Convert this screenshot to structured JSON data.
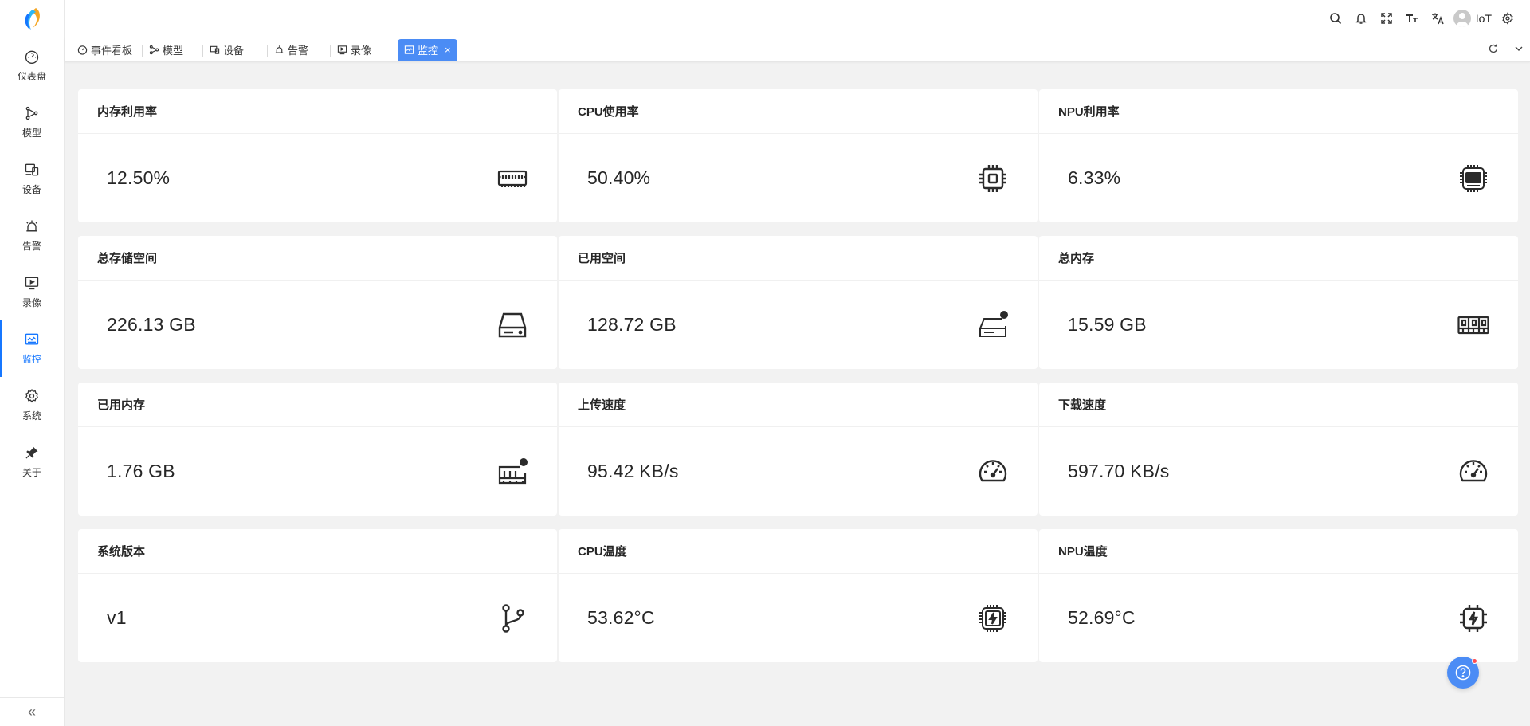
{
  "sidebar": {
    "items": [
      {
        "label": "仪表盘",
        "icon": "gauge-icon"
      },
      {
        "label": "模型",
        "icon": "graph-icon"
      },
      {
        "label": "设备",
        "icon": "devices-icon"
      },
      {
        "label": "告警",
        "icon": "alarm-icon"
      },
      {
        "label": "录像",
        "icon": "video-icon"
      },
      {
        "label": "监控",
        "icon": "monitor-icon",
        "active": true
      },
      {
        "label": "系统",
        "icon": "gear-icon"
      },
      {
        "label": "关于",
        "icon": "pin-icon"
      }
    ],
    "collapse": "«"
  },
  "header": {
    "user": "IoT"
  },
  "tabs": [
    {
      "label": "事件看板"
    },
    {
      "label": "模型"
    },
    {
      "label": "设备"
    },
    {
      "label": "告警"
    },
    {
      "label": "录像"
    },
    {
      "label": "监控",
      "active": true,
      "close": "×"
    }
  ],
  "cards": [
    {
      "title": "内存利用率",
      "value": "12.50%",
      "icon": "ram-icon"
    },
    {
      "title": "CPU使用率",
      "value": "50.40%",
      "icon": "cpu-icon"
    },
    {
      "title": "NPU利用率",
      "value": "6.33%",
      "icon": "npu-chip-icon"
    },
    {
      "title": "总存储空间",
      "value": "226.13 GB",
      "icon": "hard-drive-icon"
    },
    {
      "title": "已用空间",
      "value": "128.72 GB",
      "icon": "hard-drive-dot-icon"
    },
    {
      "title": "总内存",
      "value": "15.59 GB",
      "icon": "memory-modules-icon"
    },
    {
      "title": "已用内存",
      "value": "1.76 GB",
      "icon": "memory-dot-icon"
    },
    {
      "title": "上传速度",
      "value": "95.42 KB/s",
      "icon": "speedometer-icon"
    },
    {
      "title": "下载速度",
      "value": "597.70 KB/s",
      "icon": "speedometer-icon"
    },
    {
      "title": "系统版本",
      "value": "v1",
      "icon": "git-branch-icon"
    },
    {
      "title": "CPU温度",
      "value": "53.62°C",
      "icon": "cpu-bolt-icon"
    },
    {
      "title": "NPU温度",
      "value": "52.69°C",
      "icon": "chip-bolt-icon"
    }
  ],
  "colors": {
    "accent": "#4b8cf5",
    "active_nav": "#1677ff",
    "badge": "#ff4d4f"
  }
}
